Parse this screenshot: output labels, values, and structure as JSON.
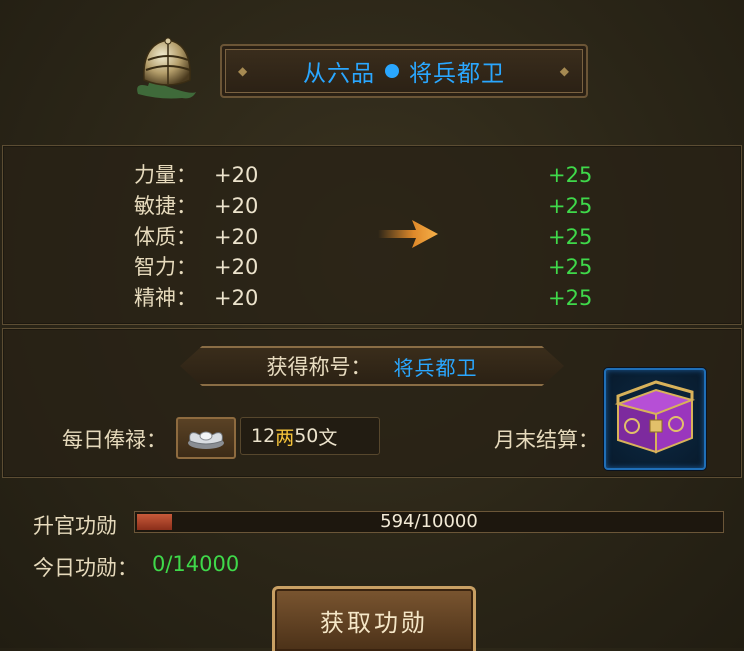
{
  "header": {
    "rank_grade": "从六品",
    "rank_title": "将兵都卫",
    "rank_color": "#2aa7ff"
  },
  "attributes": [
    {
      "label": "力量：",
      "current": "+20",
      "next": "+25"
    },
    {
      "label": "敏捷：",
      "current": "+20",
      "next": "+25"
    },
    {
      "label": "体质：",
      "current": "+20",
      "next": "+25"
    },
    {
      "label": "智力：",
      "current": "+20",
      "next": "+25"
    },
    {
      "label": "精神：",
      "current": "+20",
      "next": "+25"
    }
  ],
  "reward": {
    "title_label": "获得称号：",
    "title_value": "将兵都卫",
    "daily_salary_label": "每日俸禄：",
    "salary_amount": "12",
    "salary_unit_liang": "两",
    "salary_amount_wen": "50",
    "salary_unit_wen": "文",
    "monthly_label": "月末结算："
  },
  "progress": {
    "promotion_label": "升官功勋",
    "current": 594,
    "max": 10000,
    "text": "594/10000",
    "today_label": "今日功勋：",
    "today_value": "0/14000"
  },
  "actions": {
    "earn_merit_label": "获取功勋"
  },
  "icons": {
    "helmet": "helmet-icon",
    "arrow": "arrow-right-icon",
    "silver": "silver-ingot-icon",
    "chest": "treasure-chest-icon"
  },
  "colors": {
    "accent_blue": "#2aa7ff",
    "bonus_green": "#3fd94a",
    "gold": "#f4c23a"
  }
}
